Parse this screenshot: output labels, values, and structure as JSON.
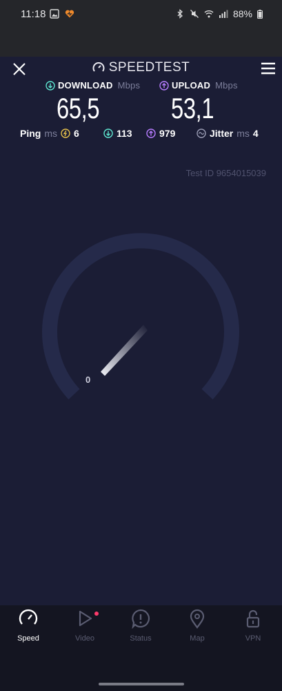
{
  "status_bar": {
    "time": "11:18",
    "battery": "88%"
  },
  "header": {
    "title": "SPEEDTEST"
  },
  "download": {
    "label": "DOWNLOAD",
    "unit": "Mbps",
    "value": "65,5",
    "color": "#5ee6d0"
  },
  "upload": {
    "label": "UPLOAD",
    "unit": "Mbps",
    "value": "53,1",
    "color": "#b77cff"
  },
  "ping": {
    "label": "Ping",
    "unit": "ms",
    "idle": "6",
    "download": "113",
    "upload": "979"
  },
  "jitter": {
    "label": "Jitter",
    "unit": "ms",
    "value": "4"
  },
  "test_id": "Test ID 9654015039",
  "gauge": {
    "min_label": "0"
  },
  "nav": {
    "items": [
      {
        "label": "Speed",
        "icon": "speed-icon",
        "active": true
      },
      {
        "label": "Video",
        "icon": "play-icon",
        "active": false
      },
      {
        "label": "Status",
        "icon": "alert-bubble-icon",
        "active": false
      },
      {
        "label": "Map",
        "icon": "map-pin-icon",
        "active": false
      },
      {
        "label": "VPN",
        "icon": "lock-icon",
        "active": false
      }
    ]
  },
  "colors": {
    "background": "#1b1d35",
    "gauge_track": "#252a4a",
    "accent_ping": "#e6c14b"
  }
}
